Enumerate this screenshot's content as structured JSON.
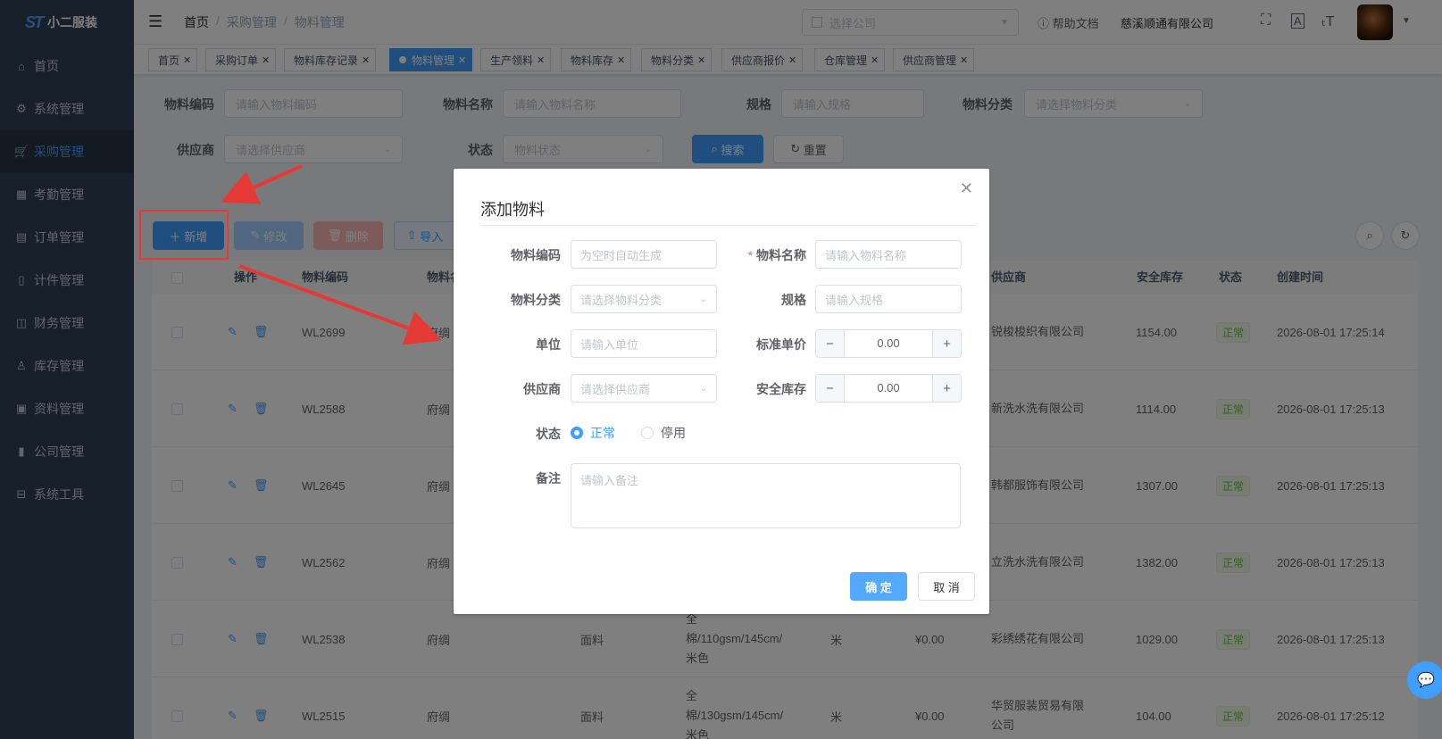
{
  "brand": {
    "logo_mark": "ST",
    "name": "小二服装"
  },
  "sidebar": {
    "items": [
      {
        "label": "首页",
        "icon": "home-icon"
      },
      {
        "label": "系统管理",
        "icon": "gear-icon"
      },
      {
        "label": "采购管理",
        "icon": "cart-icon",
        "active": true
      },
      {
        "label": "考勤管理",
        "icon": "grid-icon"
      },
      {
        "label": "订单管理",
        "icon": "clipboard-icon"
      },
      {
        "label": "计件管理",
        "icon": "book-icon"
      },
      {
        "label": "财务管理",
        "icon": "chart-icon"
      },
      {
        "label": "库存管理",
        "icon": "user-icon"
      },
      {
        "label": "资料管理",
        "icon": "document-icon"
      },
      {
        "label": "公司管理",
        "icon": "bar-chart-icon"
      },
      {
        "label": "系统工具",
        "icon": "toolbox-icon"
      }
    ]
  },
  "header": {
    "breadcrumb": [
      "首页",
      "采购管理",
      "物料管理"
    ],
    "company_select_placeholder": "选择公司",
    "help_label": "帮助文档",
    "company_name": "慈溪顺通有限公司"
  },
  "tags": [
    {
      "label": "首页"
    },
    {
      "label": "采购订单"
    },
    {
      "label": "物料库存记录"
    },
    {
      "label": "物料管理",
      "active": true
    },
    {
      "label": "生产领料"
    },
    {
      "label": "物料库存"
    },
    {
      "label": "物料分类"
    },
    {
      "label": "供应商报价"
    },
    {
      "label": "仓库管理"
    },
    {
      "label": "供应商管理"
    }
  ],
  "search": {
    "code_label": "物料编码",
    "code_placeholder": "请输入物料编码",
    "name_label": "物料名称",
    "name_placeholder": "请输入物料名称",
    "spec_label": "规格",
    "spec_placeholder": "请输入规格",
    "category_label": "物料分类",
    "category_placeholder": "请选择物料分类",
    "supplier_label": "供应商",
    "supplier_placeholder": "请选择供应商",
    "status_label": "状态",
    "status_placeholder": "物料状态",
    "search_button": "搜索",
    "reset_button": "重置"
  },
  "toolbar": {
    "add": "新增",
    "edit": "修改",
    "delete": "删除",
    "import": "导入"
  },
  "table": {
    "headers": {
      "op": "操作",
      "code": "物料编码",
      "name": "物料名",
      "supplier": "供应商",
      "stock": "安全库存",
      "status": "状态",
      "created": "创建时间"
    },
    "rows": [
      {
        "code": "WL2699",
        "name": "府绸",
        "category": "",
        "spec": [],
        "unit": "",
        "price": "",
        "supplier": [
          "锐梭梭织有限公司"
        ],
        "stock": "1154.00",
        "status": "正常",
        "created": "2026-08-01 17:25:14"
      },
      {
        "code": "WL2588",
        "name": "府绸",
        "category": "",
        "spec": [],
        "unit": "",
        "price": "",
        "supplier": [
          "新洗水洗有限公司"
        ],
        "stock": "1114.00",
        "status": "正常",
        "created": "2026-08-01 17:25:13"
      },
      {
        "code": "WL2645",
        "name": "府绸",
        "category": "",
        "spec": [],
        "unit": "",
        "price": "",
        "supplier": [
          "韩都服饰有限公司"
        ],
        "stock": "1307.00",
        "status": "正常",
        "created": "2026-08-01 17:25:13"
      },
      {
        "code": "WL2562",
        "name": "府绸",
        "category": "",
        "spec": [],
        "unit": "",
        "price": "",
        "supplier": [
          "立洗水洗有限公司"
        ],
        "stock": "1382.00",
        "status": "正常",
        "created": "2026-08-01 17:25:13"
      },
      {
        "code": "WL2538",
        "name": "府绸",
        "category": "面料",
        "spec": [
          "全",
          "棉/110gsm/145cm/",
          "米色"
        ],
        "unit": "米",
        "price": "¥0.00",
        "supplier": [
          "彩绣绣花有限公司"
        ],
        "stock": "1029.00",
        "status": "正常",
        "created": "2026-08-01 17:25:13"
      },
      {
        "code": "WL2515",
        "name": "府绸",
        "category": "面料",
        "spec": [
          "全",
          "棉/130gsm/145cm/",
          "米色"
        ],
        "unit": "米",
        "price": "¥0.00",
        "supplier": [
          "华贸服装贸易有限",
          "公司"
        ],
        "stock": "104.00",
        "status": "正常",
        "created": "2026-08-01 17:25:12"
      }
    ]
  },
  "dialog": {
    "title": "添加物料",
    "code_label": "物料编码",
    "code_placeholder": "为空时自动生成",
    "name_label": "物料名称",
    "name_placeholder": "请输入物料名称",
    "name_required_mark": "*",
    "category_label": "物料分类",
    "category_placeholder": "请选择物料分类",
    "spec_label": "规格",
    "spec_placeholder": "请输入规格",
    "unit_label": "单位",
    "unit_placeholder": "请输入单位",
    "price_label": "标准单价",
    "price_value": "0.00",
    "supplier_label": "供应商",
    "supplier_placeholder": "请选择供应商",
    "stock_label": "安全库存",
    "stock_value": "0.00",
    "status_label": "状态",
    "status_options": [
      "正常",
      "停用"
    ],
    "status_selected": "正常",
    "remark_label": "备注",
    "remark_placeholder": "请输入备注",
    "confirm_button": "确 定",
    "cancel_button": "取 消"
  },
  "colors": {
    "primary": "#409eff",
    "sidebar_bg": "#304156",
    "annotation_red": "#e53935",
    "success": "#67c23a"
  }
}
